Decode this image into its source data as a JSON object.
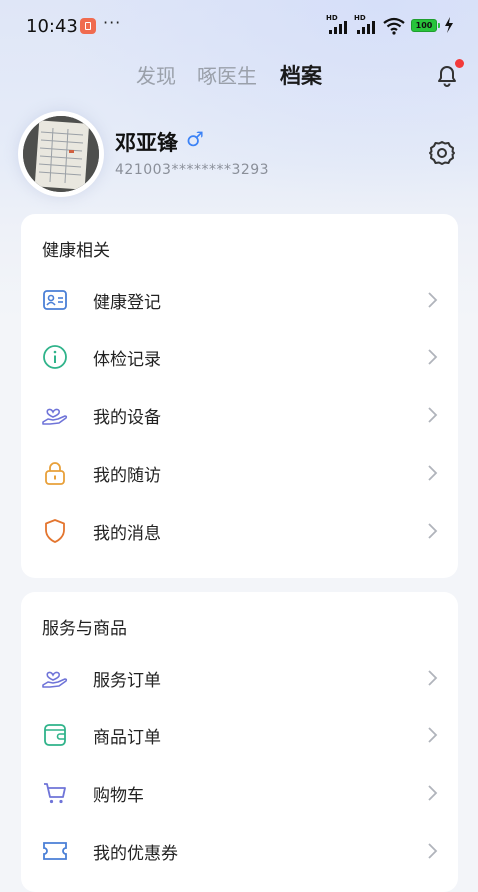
{
  "status_bar": {
    "time": "10:43",
    "more": "···",
    "battery": "100"
  },
  "tabs": [
    {
      "label": "发现"
    },
    {
      "label": "啄医生"
    },
    {
      "label": "档案"
    }
  ],
  "profile": {
    "name": "邓亚锋",
    "gender_symbol": "♂",
    "id_number": "421003********3293"
  },
  "sections": [
    {
      "title": "健康相关",
      "items": [
        {
          "label": "健康登记",
          "icon": "id-card-icon",
          "color": "#4a7fd6"
        },
        {
          "label": "体检记录",
          "icon": "info-circle-icon",
          "color": "#2fb38a"
        },
        {
          "label": "我的设备",
          "icon": "hand-heart-icon",
          "color": "#6f74d8"
        },
        {
          "label": "我的随访",
          "icon": "lock-icon",
          "color": "#e8a03a"
        },
        {
          "label": "我的消息",
          "icon": "shield-icon",
          "color": "#e3752f"
        }
      ]
    },
    {
      "title": "服务与商品",
      "items": [
        {
          "label": "服务订单",
          "icon": "hand-heart-icon",
          "color": "#6f74d8"
        },
        {
          "label": "商品订单",
          "icon": "wallet-icon",
          "color": "#2fb38a"
        },
        {
          "label": "购物车",
          "icon": "cart-icon",
          "color": "#6f74d8"
        },
        {
          "label": "我的优惠券",
          "icon": "coupon-icon",
          "color": "#4a7fd6"
        }
      ]
    }
  ]
}
